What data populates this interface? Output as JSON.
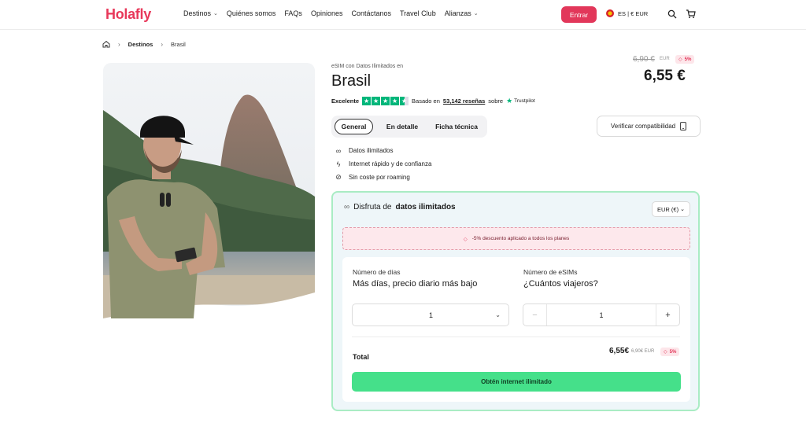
{
  "header": {
    "logo": "Holafly",
    "nav": [
      {
        "label": "Destinos",
        "dropdown": true
      },
      {
        "label": "Quiénes somos",
        "dropdown": false
      },
      {
        "label": "FAQs",
        "dropdown": false
      },
      {
        "label": "Opiniones",
        "dropdown": false
      },
      {
        "label": "Contáctanos",
        "dropdown": false
      },
      {
        "label": "Travel Club",
        "dropdown": false
      },
      {
        "label": "Alianzas",
        "dropdown": true
      }
    ],
    "login_label": "Entrar",
    "locale": "ES | € EUR",
    "icons": [
      "home-icon",
      "search-icon",
      "cart-icon"
    ]
  },
  "breadcrumb": {
    "items": [
      "Destinos",
      "Brasil"
    ]
  },
  "product": {
    "eyebrow": "eSIM con Datos Ilimitados en",
    "title": "Brasil",
    "rating_word": "Excelente",
    "reviews_prefix": "Basado en",
    "reviews_count": "53,142 reseñas",
    "reviews_suffix": "sobre",
    "trustpilot": "Trustpilot",
    "stars": 4.5,
    "price_old": "6,90 €",
    "price_old_currency": "EUR",
    "discount_badge": "5%",
    "price": "6,55 €"
  },
  "tabs": [
    {
      "label": "General",
      "active": true
    },
    {
      "label": "En detalle",
      "active": false
    },
    {
      "label": "Ficha técnica",
      "active": false
    }
  ],
  "verify_label": "Verificar compatibilidad",
  "features": [
    {
      "icon": "infinity-icon",
      "label": "Datos ilimitados"
    },
    {
      "icon": "bolt-icon",
      "label": "Internet rápido y de confianza"
    },
    {
      "icon": "no-roaming-icon",
      "label": "Sin coste por roaming"
    }
  ],
  "plan": {
    "title_prefix": "Disfruta de",
    "title_bold": "datos ilimitados",
    "currency": "EUR (€)",
    "discount_text": "-5% descuento aplicado a todos los planes",
    "days_label": "Número de días",
    "days_heading": "Más días, precio diario más bajo",
    "days_value": "1",
    "esims_label": "Número de eSIMs",
    "esims_heading": "¿Cuántos viajeros?",
    "esims_value": "1",
    "total_label": "Total",
    "total_price": "6,55€",
    "total_old": "6,90€ EUR",
    "total_badge": "5%",
    "cta": "Obtén internet ilimitado"
  },
  "colors": {
    "brand": "#e2375a",
    "cta": "#45e08a",
    "trustpilot": "#00b67a",
    "plan_border": "#a9ecc4"
  }
}
